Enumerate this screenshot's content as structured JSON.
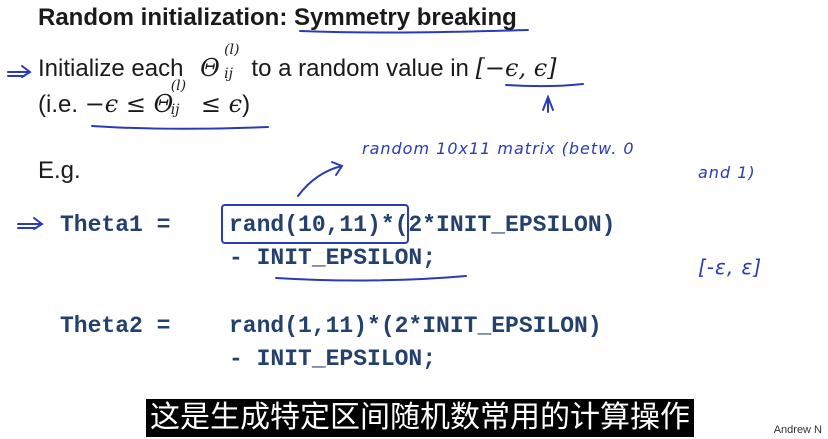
{
  "slide": {
    "title_part1": "Random initialization: ",
    "title_part2": "Symmetry breaking",
    "line1_text": "Initialize each",
    "line1_symbol": "Θ",
    "line1_sup": "(l)",
    "line1_sub": "ij",
    "line1_rest": "to a random value in",
    "line1_interval": "[−ϵ, ϵ]",
    "line2_open": "(i.e.",
    "line2_math_a": "−ϵ ≤ Θ",
    "line2_sup": "(l)",
    "line2_sub": "ij",
    "line2_math_b": "≤ ϵ",
    "line2_close": ")",
    "eg_label": "E.g.",
    "code_theta1_lhs": "Theta1  =",
    "code_theta1_rand": "rand(10,11)",
    "code_theta1_rest": "*(2*INIT_EPSILON)",
    "code_theta1_line2": "- INIT_EPSILON;",
    "code_theta2_lhs": "Theta2  =",
    "code_theta2_rhs": "rand(1,11)*(2*INIT_EPSILON)",
    "code_theta2_line2": "- INIT_EPSILON;"
  },
  "annotations": {
    "note_line1": "random  10x11  matrix    (betw. 0",
    "note_line2": "and 1)",
    "interval_note": "[-ε, ε]"
  },
  "subtitle": "这是生成特定区间随机数常用的计算操作",
  "author": "Andrew N",
  "colors": {
    "ink_blue": "#2a3bb8",
    "code_blue": "#24406e"
  }
}
